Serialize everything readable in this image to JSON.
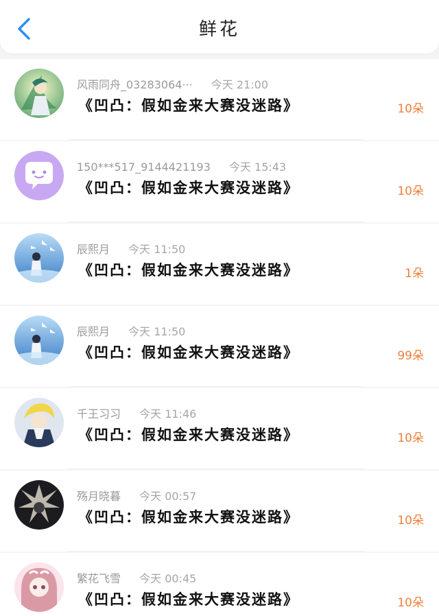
{
  "header": {
    "title": "鲜花"
  },
  "items": [
    {
      "name": "风雨同舟_03283064···",
      "time": "今天 21:00",
      "work": "《凹凸：假如金来大赛没迷路》",
      "count": "10朵",
      "avatar": "green-fairy"
    },
    {
      "name": "150***517_9144421193",
      "time": "今天 15:43",
      "work": "《凹凸：假如金来大赛没迷路》",
      "count": "10朵",
      "avatar": "chat-bubble"
    },
    {
      "name": "辰熙月",
      "time": "今天 11:50",
      "work": "《凹凸：假如金来大赛没迷路》",
      "count": "1朵",
      "avatar": "blue-birds"
    },
    {
      "name": "辰熙月",
      "time": "今天 11:50",
      "work": "《凹凸：假如金来大赛没迷路》",
      "count": "99朵",
      "avatar": "blue-birds"
    },
    {
      "name": "千王习习",
      "time": "今天 11:46",
      "work": "《凹凸：假如金来大赛没迷路》",
      "count": "10朵",
      "avatar": "blonde-boy"
    },
    {
      "name": "殇月晓暮",
      "time": "今天 00:57",
      "work": "《凹凸：假如金来大赛没迷路》",
      "count": "10朵",
      "avatar": "dark-angel"
    },
    {
      "name": "繁花飞雪",
      "time": "今天 00:45",
      "work": "《凹凸：假如金来大赛没迷路》",
      "count": "10朵",
      "avatar": "pink-girl"
    }
  ],
  "colors": {
    "accent": "#f07f3a",
    "back_icon": "#2f8ef0"
  }
}
